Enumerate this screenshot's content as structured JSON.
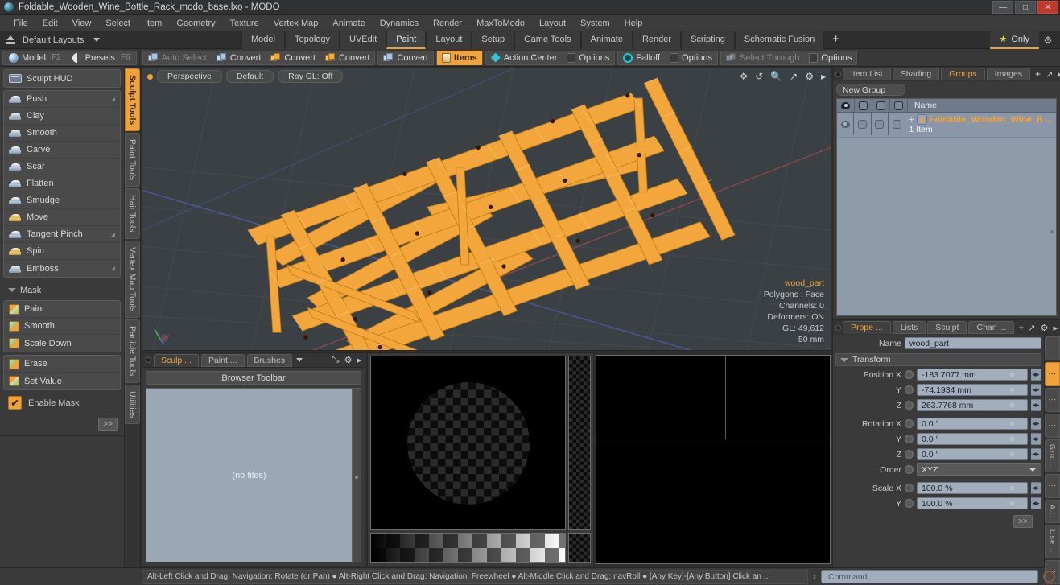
{
  "window": {
    "title": "Foldable_Wooden_Wine_Bottle_Rack_modo_base.lxo - MODO",
    "minimize": "—",
    "maximize": "□",
    "close": "✕"
  },
  "menubar": {
    "items": [
      "File",
      "Edit",
      "View",
      "Select",
      "Item",
      "Geometry",
      "Texture",
      "Vertex Map",
      "Animate",
      "Dynamics",
      "Render",
      "MaxToModo",
      "Layout",
      "System",
      "Help"
    ]
  },
  "layoutbar": {
    "layouts_label": "Default Layouts",
    "tabs": [
      "Model",
      "Topology",
      "UVEdit",
      "Paint",
      "Layout",
      "Setup",
      "Game Tools",
      "Animate",
      "Render",
      "Scripting",
      "Schematic Fusion"
    ],
    "active_tab": "Paint",
    "add_label": "+",
    "only_label": "Only",
    "star_glyph": "★",
    "gear_glyph": "⚙"
  },
  "modebar": {
    "model_label": "Model",
    "model_key": "F2",
    "presets_label": "Presets",
    "presets_key": "F6",
    "buttons": [
      {
        "label": "Auto Select",
        "state": "dim",
        "icon": "cube-blue-icon"
      },
      {
        "label": "Convert",
        "state": "normal",
        "icon": "cube-blue-icon"
      },
      {
        "label": "Convert",
        "state": "normal",
        "icon": "cube-gold-icon"
      },
      {
        "label": "Convert",
        "state": "normal",
        "icon": "cube-gold-icon"
      },
      {
        "label": "Convert",
        "state": "normal",
        "icon": "cube-blue-icon"
      },
      {
        "label": "Items",
        "state": "active",
        "icon": "items-icon"
      },
      {
        "label": "Action Center",
        "state": "normal",
        "icon": "action-center-icon"
      },
      {
        "label": "Options",
        "state": "normal",
        "icon": "options-square-icon"
      },
      {
        "label": "Falloff",
        "state": "normal",
        "icon": "falloff-ring-icon"
      },
      {
        "label": "Options",
        "state": "normal",
        "icon": "options-square-icon"
      },
      {
        "label": "Select Through",
        "state": "dim",
        "icon": "select-through-icon"
      },
      {
        "label": "Options",
        "state": "normal",
        "icon": "options-square-icon"
      }
    ]
  },
  "left_panel": {
    "sculpt_hud": "Sculpt HUD",
    "tools": [
      "Push",
      "Clay",
      "Smooth",
      "Carve",
      "Scar",
      "Flatten",
      "Smudge",
      "Move",
      "Tangent Pinch",
      "Spin",
      "Emboss"
    ],
    "mask_header": "Mask",
    "mask_tools": [
      "Paint",
      "Smooth",
      "Scale Down"
    ],
    "mask_tools2": [
      "Erase",
      "Set Value"
    ],
    "enable_mask": "Enable Mask",
    "check_glyph": "✔",
    "more_label": ">>",
    "vertical_tabs": [
      "Sculpt Tools",
      "Paint Tools",
      "Hair Tools",
      "Vertex Map Tools",
      "Particle Tools",
      "Utilities"
    ],
    "vertical_active": "Sculpt Tools"
  },
  "viewport": {
    "view_mode": "Perspective",
    "shading": "Default",
    "ray_gl": "Ray GL: Off",
    "tool_icons": [
      "pan-icon",
      "rotate-icon",
      "zoom-icon",
      "fit-icon",
      "gear-icon",
      "chevron-right-icon"
    ],
    "info": {
      "name": "wood_part",
      "polygons": "Polygons : Face",
      "channels": "Channels: 0",
      "deformers": "Deformers: ON",
      "gl": "GL: 49,612",
      "scale": "50 mm"
    }
  },
  "browser": {
    "tabs": [
      "Sculp ...",
      "Paint ...",
      "Brushes"
    ],
    "active_tab": "Sculp ...",
    "toolbar_label": "Browser Toolbar",
    "empty_label": "(no files)",
    "gear_glyph": "⚙",
    "expand_glyph": "⤡",
    "chevron_glyph": "▸"
  },
  "right_panel": {
    "top_tabs": [
      "Item List",
      "Shading",
      "Groups",
      "Images"
    ],
    "top_active": "Groups",
    "add_label": "+",
    "new_group": "New Group",
    "table": {
      "columns": [
        "eye-icon",
        "render-icon",
        "wire-icon",
        "lock-icon"
      ],
      "name_header": "Name",
      "rows": [
        {
          "name": "Foldable_Wooden_Wine_B ...",
          "sub": "1 Item"
        }
      ]
    },
    "bottom_tabs": [
      "Prope ...",
      "Lists",
      "Sculpt",
      "Chan ..."
    ],
    "bottom_active": "Prope ...",
    "name_label": "Name",
    "name_value": "wood_part",
    "transform_header": "Transform",
    "properties": [
      {
        "label": "Position X",
        "value": "-183.7077 mm",
        "type": "number"
      },
      {
        "label": "Y",
        "value": "-74.1934 mm",
        "type": "number"
      },
      {
        "label": "Z",
        "value": "263.7768 mm",
        "type": "number"
      },
      {
        "label": "Rotation X",
        "value": "0.0 °",
        "type": "number"
      },
      {
        "label": "Y",
        "value": "0.0 °",
        "type": "number"
      },
      {
        "label": "Z",
        "value": "0.0 °",
        "type": "number"
      },
      {
        "label": "Order",
        "value": "XYZ",
        "type": "select"
      },
      {
        "label": "Scale X",
        "value": "100.0 %",
        "type": "number"
      },
      {
        "label": "Y",
        "value": "100.0 %",
        "type": "number"
      }
    ],
    "more_label": ">>",
    "vertical_tabs": [
      "⋮",
      "⋮",
      "⋮",
      "⋮",
      "Gro...",
      "⋮",
      "A...",
      "Use...",
      "⋮"
    ],
    "vertical_active_index": 1
  },
  "statusbar": {
    "hint": "Alt-Left Click and Drag: Navigation: Rotate (or Pan) ● Alt-Right Click and Drag: Navigation: Freewheel ● Alt-Middle Click and Drag: navRoll ● [Any Key]-[Any Button] Click an ...",
    "arrow": "›",
    "command_placeholder": "Command"
  },
  "colors": {
    "accent": "#f0a33a",
    "model_wire": "#f5a623",
    "viewport_bg": "#3b4045",
    "panel_bg": "#3a3a3a"
  }
}
